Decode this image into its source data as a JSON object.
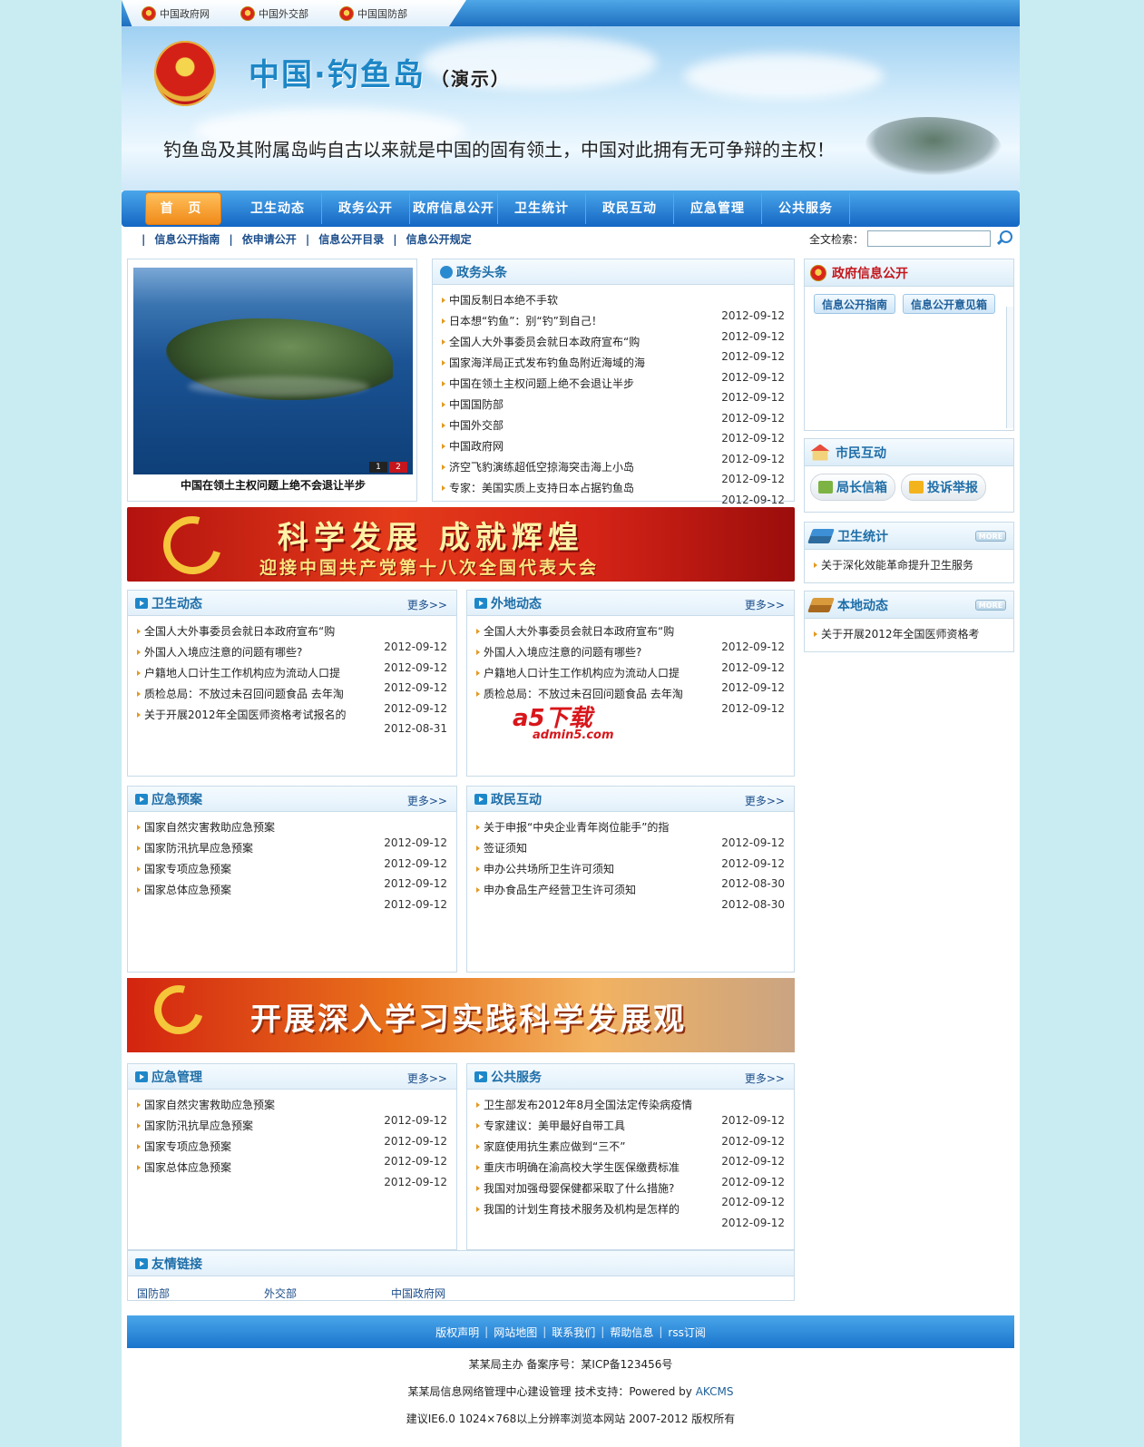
{
  "top_links": [
    "中国政府网",
    "中国外交部",
    "中国国防部"
  ],
  "header": {
    "title": "中国·钓鱼岛",
    "title_suffix": "（演示）",
    "slogan": "钓鱼岛及其附属岛屿自古以来就是中国的固有领土，中国对此拥有无可争辩的主权！"
  },
  "nav": [
    "首 页",
    "卫生动态",
    "政务公开",
    "政府信息公开",
    "卫生统计",
    "政民互动",
    "应急管理",
    "公共服务"
  ],
  "subnav": [
    "信息公开指南",
    "依申请公开",
    "信息公开目录",
    "信息公开规定"
  ],
  "search": {
    "label": "全文检索：",
    "value": ""
  },
  "slideshow": {
    "caption": "中国在领土主权问题上绝不会退让半步",
    "pages": [
      "1",
      "2"
    ],
    "active_page": "2"
  },
  "headlines": {
    "title": "政务头条",
    "items": [
      "中国反制日本绝不手软",
      "日本想“钓鱼”：别“钓”到自己！",
      "全国人大外事委员会就日本政府宣布“购",
      "国家海洋局正式发布钓鱼岛附近海域的海",
      "中国在领土主权问题上绝不会退让半步",
      "中国国防部",
      "中国外交部",
      "中国政府网",
      "济空飞豹演练超低空掠海突击海上小岛",
      "专家：美国实质上支持日本占据钓鱼岛"
    ],
    "dates": [
      "2012-09-12",
      "2012-09-12",
      "2012-09-12",
      "2012-09-12",
      "2012-09-12",
      "2012-09-12",
      "2012-09-12",
      "2012-09-12",
      "2012-09-12",
      "2012-09-12"
    ]
  },
  "banner1": {
    "line1": "科学发展 成就辉煌",
    "line2": "迎接中国共产党第十八次全国代表大会"
  },
  "banner2": {
    "line1": "开展深入学习实践科学发展观"
  },
  "more_label": "更多>>",
  "panels": {
    "health_news": {
      "title": "卫生动态",
      "items": [
        "全国人大外事委员会就日本政府宣布“购",
        "外国人入境应注意的问题有哪些?",
        "户籍地人口计生工作机构应为流动人口提",
        "质检总局：不放过未召回问题食品 去年淘",
        "关于开展2012年全国医师资格考试报名的"
      ],
      "dates": [
        "2012-09-12",
        "2012-09-12",
        "2012-09-12",
        "2012-09-12",
        "2012-08-31"
      ]
    },
    "other_news": {
      "title": "外地动态",
      "items": [
        "全国人大外事委员会就日本政府宣布“购",
        "外国人入境应注意的问题有哪些?",
        "户籍地人口计生工作机构应为流动人口提",
        "质检总局：不放过未召回问题食品 去年淘"
      ],
      "dates": [
        "2012-09-12",
        "2012-09-12",
        "2012-09-12",
        "2012-09-12"
      ]
    },
    "emergency_plan": {
      "title": "应急预案",
      "items": [
        "国家自然灾害救助应急预案",
        "国家防汛抗旱应急预案",
        "国家专项应急预案",
        "国家总体应急预案"
      ],
      "dates": [
        "2012-09-12",
        "2012-09-12",
        "2012-09-12",
        "2012-09-12"
      ]
    },
    "interaction": {
      "title": "政民互动",
      "items": [
        "关于申报“中央企业青年岗位能手”的指",
        "签证须知",
        "申办公共场所卫生许可须知",
        "申办食品生产经营卫生许可须知"
      ],
      "dates": [
        "2012-09-12",
        "2012-09-12",
        "2012-08-30",
        "2012-08-30"
      ]
    },
    "emergency_mgmt": {
      "title": "应急管理",
      "items": [
        "国家自然灾害救助应急预案",
        "国家防汛抗旱应急预案",
        "国家专项应急预案",
        "国家总体应急预案"
      ],
      "dates": [
        "2012-09-12",
        "2012-09-12",
        "2012-09-12",
        "2012-09-12"
      ]
    },
    "public_service": {
      "title": "公共服务",
      "items": [
        "卫生部发布2012年8月全国法定传染病疫情",
        "专家建议：美甲最好自带工具",
        "家庭使用抗生素应做到“三不”",
        "重庆市明确在渝高校大学生医保缴费标准",
        "我国对加强母婴保健都采取了什么措施?",
        "我国的计划生育技术服务及机构是怎样的"
      ],
      "dates": [
        "2012-09-12",
        "2012-09-12",
        "2012-09-12",
        "2012-09-12",
        "2012-09-12",
        "2012-09-12"
      ]
    }
  },
  "watermark": {
    "logo": "a5下载",
    "url": "admin5.com"
  },
  "right": {
    "gov_info": {
      "title": "政府信息公开",
      "tabs": [
        "信息公开指南",
        "信息公开意见箱"
      ]
    },
    "citizen": {
      "title": "市民互动",
      "buttons": [
        "局长信箱",
        "投诉举报"
      ]
    },
    "stats": {
      "title": "卫生统计",
      "more": "MORE",
      "items": [
        "关于深化效能革命提升卫生服务"
      ]
    },
    "local": {
      "title": "本地动态",
      "more": "MORE",
      "items": [
        "关于开展2012年全国医师资格考"
      ]
    }
  },
  "friend_links": {
    "title": "友情链接",
    "items": [
      "国防部",
      "外交部",
      "中国政府网"
    ]
  },
  "footer": {
    "links": [
      "版权声明",
      "网站地图",
      "联系我们",
      "帮助信息",
      "rss订阅"
    ],
    "line1": "某某局主办 备案序号：某ICP备123456号",
    "line2": "某某局信息网络管理中心建设管理 技术支持：Powered by",
    "line2_link": "AKCMS",
    "line3": "建议IE6.0 1024×768以上分辨率浏览本网站 2007-2012 版权所有"
  },
  "colors": {
    "page_bg": "#c9ecf2",
    "nav_blue": "#1a74cc",
    "accent_orange": "#f08a1a",
    "link_blue": "#1b4d8a"
  }
}
